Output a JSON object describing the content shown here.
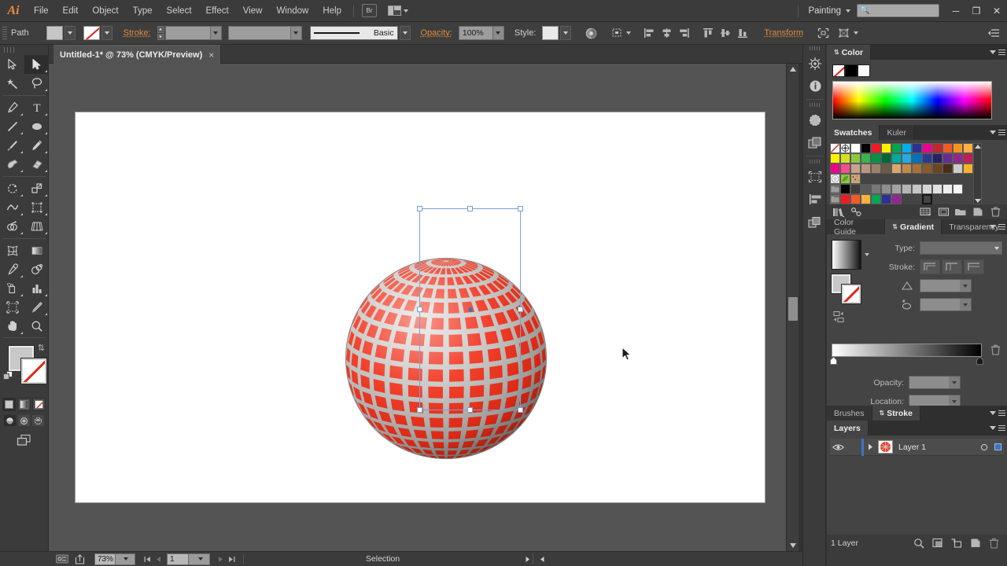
{
  "app": {
    "name": "Adobe Illustrator",
    "logo_text": "Ai",
    "workspace": "Painting",
    "search_placeholder": ""
  },
  "menubar": {
    "items": [
      "File",
      "Edit",
      "Object",
      "Type",
      "Select",
      "Effect",
      "View",
      "Window",
      "Help"
    ],
    "bridge_label": "Br",
    "minimize": "─",
    "restore": "❐",
    "close": "✕"
  },
  "controlbar": {
    "object_type": "Path",
    "stroke_label": "Stroke:",
    "stroke_weight": "",
    "stroke_profile": "",
    "brush_name": "Basic",
    "opacity_label": "Opacity:",
    "opacity_value": "100%",
    "style_label": "Style:",
    "transform_label": "Transform",
    "align_icons": [
      "align-left-icon",
      "align-center-horizontal-icon",
      "align-right-icon",
      "align-top-icon",
      "align-middle-vertical-icon",
      "align-bottom-icon"
    ],
    "recolor_icon": "recolor-artwork-icon",
    "shape_icon": "shape-options-icon",
    "isolate_icon": "isolate-group-icon",
    "mask_icon": "opacity-mask-icon",
    "panel_menu_icon": "control-panel-menu-icon"
  },
  "document": {
    "tab_title": "Untitled-1* @ 73% (CMYK/Preview)",
    "close_label": "×"
  },
  "toolbar": {
    "tools": [
      {
        "name": "selection-tool",
        "active": false,
        "hidden": false
      },
      {
        "name": "direct-selection-tool",
        "active": true,
        "hidden": false
      },
      {
        "name": "magic-wand-tool",
        "active": false,
        "hidden": false
      },
      {
        "name": "lasso-tool",
        "active": false,
        "hidden": false
      },
      {
        "name": "pen-tool",
        "active": false,
        "hidden": false
      },
      {
        "name": "type-tool",
        "active": false,
        "hidden": false
      },
      {
        "name": "line-segment-tool",
        "active": false,
        "hidden": false
      },
      {
        "name": "ellipse-tool",
        "active": false,
        "hidden": false
      },
      {
        "name": "paintbrush-tool",
        "active": false,
        "hidden": false
      },
      {
        "name": "pencil-tool",
        "active": false,
        "hidden": false
      },
      {
        "name": "blob-brush-tool",
        "active": false,
        "hidden": false
      },
      {
        "name": "eraser-tool",
        "active": false,
        "hidden": false
      },
      {
        "name": "rotate-tool",
        "active": false,
        "hidden": false
      },
      {
        "name": "scale-tool",
        "active": false,
        "hidden": false
      },
      {
        "name": "width-tool",
        "active": false,
        "hidden": false
      },
      {
        "name": "free-transform-tool",
        "active": false,
        "hidden": false
      },
      {
        "name": "shape-builder-tool",
        "active": false,
        "hidden": false
      },
      {
        "name": "perspective-grid-tool",
        "active": false,
        "hidden": false
      },
      {
        "name": "mesh-tool",
        "active": false,
        "hidden": false
      },
      {
        "name": "gradient-tool",
        "active": false,
        "hidden": false
      },
      {
        "name": "eyedropper-tool",
        "active": false,
        "hidden": false
      },
      {
        "name": "blend-tool",
        "active": false,
        "hidden": false
      },
      {
        "name": "symbol-sprayer-tool",
        "active": false,
        "hidden": false
      },
      {
        "name": "column-graph-tool",
        "active": false,
        "hidden": false
      },
      {
        "name": "artboard-tool",
        "active": false,
        "hidden": false
      },
      {
        "name": "slice-tool",
        "active": false,
        "hidden": false
      },
      {
        "name": "hand-tool",
        "active": false,
        "hidden": false
      },
      {
        "name": "zoom-tool",
        "active": false,
        "hidden": false
      }
    ],
    "fill_color": "#c8c8c8",
    "stroke_color": "none",
    "swap_icon": "swap-fill-stroke-icon",
    "default_icon": "default-fill-stroke-icon",
    "color_modes": [
      "color-mode-icon",
      "gradient-mode-icon",
      "none-mode-icon"
    ],
    "draw_modes": [
      "draw-normal-icon",
      "draw-behind-icon",
      "draw-inside-icon"
    ],
    "screen_mode_icon": "change-screen-mode-icon"
  },
  "canvas": {
    "artwork_name": "3d-revolved-sphere",
    "artwork_description": "3D revolved red and gray grid sphere",
    "sphere_red": "#f22d17",
    "sphere_gray": "#b8b6b3",
    "selection_color": "#7ba0d0",
    "cursor_icon": "arrow-cursor"
  },
  "statusbar": {
    "zoom_value": "73%",
    "page_value": "1",
    "status_text": "Selection",
    "icons": [
      "go-to-bridge-icon",
      "share-on-behance-icon"
    ],
    "nav_first": "⏮",
    "nav_prev": "◀",
    "nav_next": "▶",
    "nav_last": "⏭"
  },
  "iconrail": {
    "buttons": [
      "brushes-library-icon",
      "info-panel-icon",
      "appearance-panel-icon",
      "graphic-styles-icon",
      "artboards-panel-icon",
      "align-panel-icon",
      "pathfinder-panel-icon"
    ]
  },
  "panels": {
    "color": {
      "tabs": [
        {
          "label": "Color",
          "active": true
        }
      ],
      "swatches": [
        "none",
        "#000000",
        "#ffffff"
      ],
      "spectrum_name": "color-spectrum-ramp"
    },
    "swatches": {
      "tabs": [
        {
          "label": "Swatches",
          "active": true
        },
        {
          "label": "Kuler",
          "active": false
        }
      ],
      "rows": [
        [
          "none",
          "registration",
          "#ffffff",
          "#000000",
          "#ed1c24",
          "#fff200",
          "#00a651",
          "#00aeef",
          "#2e3192",
          "#ec008c",
          "#c1272d",
          "#f15a29",
          "#f7941e",
          "#fbb040"
        ],
        [
          "#fff200",
          "#d7df23",
          "#8dc63f",
          "#39b54a",
          "#009444",
          "#006838",
          "#00a99d",
          "#27aae1",
          "#0072bc",
          "#2b3990",
          "#262262",
          "#662d91",
          "#92278f",
          "#bf1e56"
        ],
        [
          "#ec048c",
          "#f0508f",
          "#c4a48c",
          "#b8977e",
          "#9b8068",
          "#6d5a45",
          "#d7a86e",
          "#c08a4b",
          "#a9703c",
          "#8a5a2b",
          "#6b4420",
          "#4a2d14",
          "#cccccc",
          "#f7b22b"
        ],
        [
          "pattern-dots",
          "pattern-leaf",
          "pattern-confetti"
        ],
        [
          "folder",
          "#000000",
          "#3d3d3d",
          "#5a5a5a",
          "#777777",
          "#8f8f8f",
          "#a3a3a3",
          "#b5b5b5",
          "#c7c7c7",
          "#d6d6d6",
          "#e3e3e3",
          "#efefef",
          "#f7f7f7"
        ],
        [
          "folder",
          "#ed1c24",
          "#f15a29",
          "#fbb040",
          "#00a651",
          "#2e3192",
          "#92278f"
        ]
      ],
      "selected_index": "row5-col9",
      "footer_buttons": [
        "swatch-libraries-icon",
        "show-swatch-kinds-icon",
        "swatch-options-icon",
        "color-groups-icon",
        "new-color-group-icon",
        "new-swatch-icon",
        "delete-swatch-icon"
      ]
    },
    "gradient": {
      "tabs": [
        {
          "label": "Color Guide",
          "active": false
        },
        {
          "label": "Gradient",
          "active": true
        },
        {
          "label": "Transparency",
          "active": false
        }
      ],
      "type_label": "Type:",
      "type_value": "",
      "stroke_label": "Stroke:",
      "angle_label": "",
      "angle_value": "",
      "aspect_label": "",
      "aspect_value": "",
      "opacity_label": "Opacity:",
      "opacity_value": "",
      "location_label": "Location:",
      "location_value": "",
      "gradient_start": "#ffffff",
      "gradient_end": "#000000",
      "delete_stop_icon": "delete-gradient-stop-icon",
      "reverse_icon": "reverse-gradient-icon"
    },
    "brushes_stroke": {
      "tabs": [
        {
          "label": "Brushes",
          "active": false
        },
        {
          "label": "Stroke",
          "active": true
        }
      ]
    },
    "layers": {
      "tabs": [
        {
          "label": "Layers",
          "active": true
        }
      ],
      "rows": [
        {
          "name": "Layer 1",
          "visible": true,
          "locked": false,
          "color": "#3c74c8",
          "selected": true
        }
      ],
      "footer_count": "1 Layer",
      "footer_buttons": [
        "locate-object-icon",
        "make-clipping-mask-icon",
        "create-new-sublayer-icon",
        "create-new-layer-icon",
        "delete-selection-icon"
      ]
    }
  }
}
